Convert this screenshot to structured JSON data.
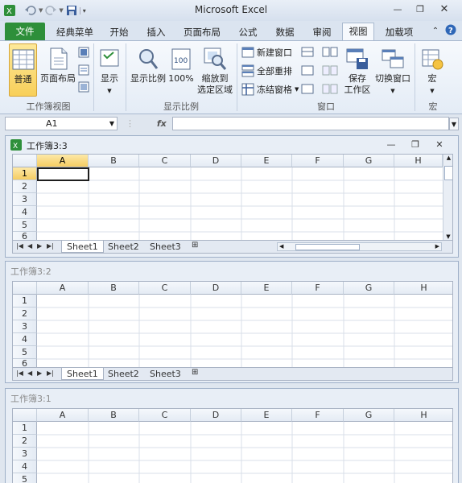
{
  "app_title": "Microsoft Excel",
  "colors": {
    "file_tab": "#2e8f3a",
    "active_button": "#f8cf5a",
    "header_selected": "#f5cc62"
  },
  "tabs": [
    "文件",
    "经典菜单",
    "开始",
    "插入",
    "页面布局",
    "公式",
    "数据",
    "审阅",
    "视图",
    "加载项"
  ],
  "ribbon": {
    "group1": {
      "label": "工作簿视图",
      "normal": "普通",
      "page_layout": "页面布局"
    },
    "show": {
      "label": "显示"
    },
    "group2": {
      "label": "显示比例",
      "zoom": "显示比例",
      "zoom100": "100%",
      "zoom_sel_1": "缩放到",
      "zoom_sel_2": "选定区域"
    },
    "group3": {
      "label": "窗口",
      "new_window": "新建窗口",
      "arrange_all": "全部重排",
      "freeze": "冻结窗格",
      "save_ws_1": "保存",
      "save_ws_2": "工作区",
      "switch": "切换窗口"
    },
    "group4": {
      "label": "宏",
      "macros": "宏"
    }
  },
  "formula_bar": {
    "name_box": "A1",
    "fx": "fx",
    "formula": ""
  },
  "windows": [
    {
      "title": "工作簿3:3"
    },
    {
      "title": "工作簿3:2"
    },
    {
      "title": "工作簿3:1"
    }
  ],
  "columns": [
    "A",
    "B",
    "C",
    "D",
    "E",
    "F",
    "G",
    "H"
  ],
  "rows": [
    "1",
    "2",
    "3",
    "4",
    "5",
    "6"
  ],
  "sheets": [
    "Sheet1",
    "Sheet2",
    "Sheet3"
  ]
}
